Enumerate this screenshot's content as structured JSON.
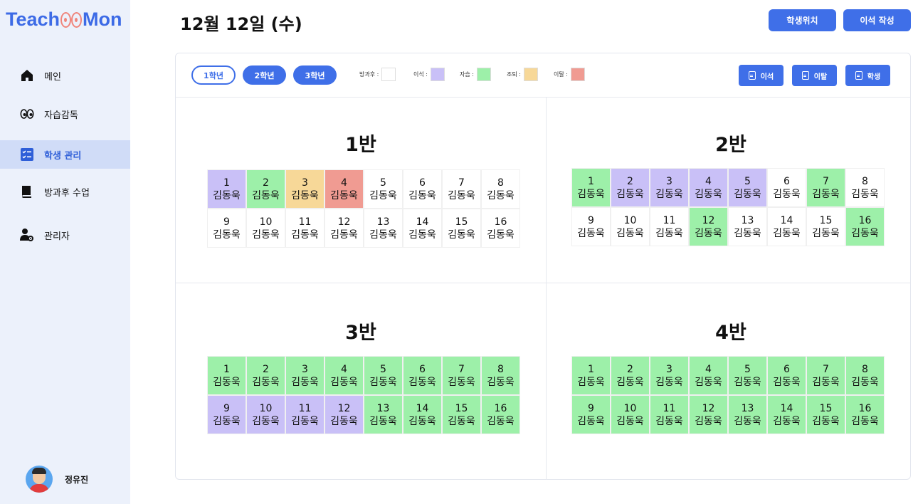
{
  "app": {
    "logo_left": "Teach",
    "logo_right": "Mon"
  },
  "sidebar": {
    "items": [
      {
        "label": "메인",
        "icon": "home-icon",
        "active": false
      },
      {
        "label": "자습감독",
        "icon": "eyes-icon",
        "active": false
      },
      {
        "label": "학생 관리",
        "icon": "checklist-icon",
        "active": true
      },
      {
        "label": "방과후 수업",
        "icon": "book-icon",
        "active": false
      },
      {
        "label": "관리자",
        "icon": "admin-icon",
        "active": false
      }
    ],
    "user": {
      "name": "정유진"
    }
  },
  "header": {
    "date": "12월 12일 (수)",
    "student_location_label": "학생위치",
    "write_leave_label": "이석 작성"
  },
  "toolbar": {
    "grades": [
      "1학년",
      "2학년",
      "3학년"
    ],
    "legend": [
      {
        "label": "방과후 :",
        "color": "#ffffff"
      },
      {
        "label": "이석 :",
        "color": "#c9c0f7"
      },
      {
        "label": "자습 :",
        "color": "#9df0a9"
      },
      {
        "label": "조퇴 :",
        "color": "#f7d898"
      },
      {
        "label": "이탈 :",
        "color": "#f09b92"
      }
    ],
    "actions": [
      "이석",
      "이탈",
      "학생"
    ]
  },
  "colors": {
    "accent": "#3f6fe8",
    "none": "#ffffff",
    "leave": "#c9c0f7",
    "study": "#9df0a9",
    "early": "#f7d898",
    "away": "#f09b92"
  },
  "classes": [
    {
      "title": "1반",
      "seats": [
        {
          "num": "1",
          "name": "김동욱",
          "status": "leave"
        },
        {
          "num": "2",
          "name": "김동욱",
          "status": "study"
        },
        {
          "num": "3",
          "name": "김동욱",
          "status": "early"
        },
        {
          "num": "4",
          "name": "김동욱",
          "status": "away"
        },
        {
          "num": "5",
          "name": "김동욱",
          "status": "none"
        },
        {
          "num": "6",
          "name": "김동욱",
          "status": "none"
        },
        {
          "num": "7",
          "name": "김동욱",
          "status": "none"
        },
        {
          "num": "8",
          "name": "김동욱",
          "status": "none"
        },
        {
          "num": "9",
          "name": "김동욱",
          "status": "none"
        },
        {
          "num": "10",
          "name": "김동욱",
          "status": "none"
        },
        {
          "num": "11",
          "name": "김동욱",
          "status": "none"
        },
        {
          "num": "12",
          "name": "김동욱",
          "status": "none"
        },
        {
          "num": "13",
          "name": "김동욱",
          "status": "none"
        },
        {
          "num": "14",
          "name": "김동욱",
          "status": "none"
        },
        {
          "num": "15",
          "name": "김동욱",
          "status": "none"
        },
        {
          "num": "16",
          "name": "김동욱",
          "status": "none"
        }
      ]
    },
    {
      "title": "2반",
      "seats": [
        {
          "num": "1",
          "name": "김동욱",
          "status": "study"
        },
        {
          "num": "2",
          "name": "김동욱",
          "status": "leave"
        },
        {
          "num": "3",
          "name": "김동욱",
          "status": "leave"
        },
        {
          "num": "4",
          "name": "김동욱",
          "status": "leave"
        },
        {
          "num": "5",
          "name": "김동욱",
          "status": "leave"
        },
        {
          "num": "6",
          "name": "김동욱",
          "status": "none"
        },
        {
          "num": "7",
          "name": "김동욱",
          "status": "study"
        },
        {
          "num": "8",
          "name": "김동욱",
          "status": "none"
        },
        {
          "num": "9",
          "name": "김동욱",
          "status": "none"
        },
        {
          "num": "10",
          "name": "김동욱",
          "status": "none"
        },
        {
          "num": "11",
          "name": "김동욱",
          "status": "none"
        },
        {
          "num": "12",
          "name": "김동욱",
          "status": "study"
        },
        {
          "num": "13",
          "name": "김동욱",
          "status": "none"
        },
        {
          "num": "14",
          "name": "김동욱",
          "status": "none"
        },
        {
          "num": "15",
          "name": "김동욱",
          "status": "none"
        },
        {
          "num": "16",
          "name": "김동욱",
          "status": "study"
        }
      ]
    },
    {
      "title": "3반",
      "seats": [
        {
          "num": "1",
          "name": "김동욱",
          "status": "study"
        },
        {
          "num": "2",
          "name": "김동욱",
          "status": "study"
        },
        {
          "num": "3",
          "name": "김동욱",
          "status": "study"
        },
        {
          "num": "4",
          "name": "김동욱",
          "status": "study"
        },
        {
          "num": "5",
          "name": "김동욱",
          "status": "study"
        },
        {
          "num": "6",
          "name": "김동욱",
          "status": "study"
        },
        {
          "num": "7",
          "name": "김동욱",
          "status": "study"
        },
        {
          "num": "8",
          "name": "김동욱",
          "status": "study"
        },
        {
          "num": "9",
          "name": "김동욱",
          "status": "leave"
        },
        {
          "num": "10",
          "name": "김동욱",
          "status": "leave"
        },
        {
          "num": "11",
          "name": "김동욱",
          "status": "leave"
        },
        {
          "num": "12",
          "name": "김동욱",
          "status": "leave"
        },
        {
          "num": "13",
          "name": "김동욱",
          "status": "study"
        },
        {
          "num": "14",
          "name": "김동욱",
          "status": "study"
        },
        {
          "num": "15",
          "name": "김동욱",
          "status": "study"
        },
        {
          "num": "16",
          "name": "김동욱",
          "status": "study"
        }
      ]
    },
    {
      "title": "4반",
      "seats": [
        {
          "num": "1",
          "name": "김동욱",
          "status": "study"
        },
        {
          "num": "2",
          "name": "김동욱",
          "status": "study"
        },
        {
          "num": "3",
          "name": "김동욱",
          "status": "study"
        },
        {
          "num": "4",
          "name": "김동욱",
          "status": "study"
        },
        {
          "num": "5",
          "name": "김동욱",
          "status": "study"
        },
        {
          "num": "6",
          "name": "김동욱",
          "status": "study"
        },
        {
          "num": "7",
          "name": "김동욱",
          "status": "study"
        },
        {
          "num": "8",
          "name": "김동욱",
          "status": "study"
        },
        {
          "num": "9",
          "name": "김동욱",
          "status": "study"
        },
        {
          "num": "10",
          "name": "김동욱",
          "status": "study"
        },
        {
          "num": "11",
          "name": "김동욱",
          "status": "study"
        },
        {
          "num": "12",
          "name": "김동욱",
          "status": "study"
        },
        {
          "num": "13",
          "name": "김동욱",
          "status": "study"
        },
        {
          "num": "14",
          "name": "김동욱",
          "status": "study"
        },
        {
          "num": "15",
          "name": "김동욱",
          "status": "study"
        },
        {
          "num": "16",
          "name": "김동욱",
          "status": "study"
        }
      ]
    }
  ]
}
